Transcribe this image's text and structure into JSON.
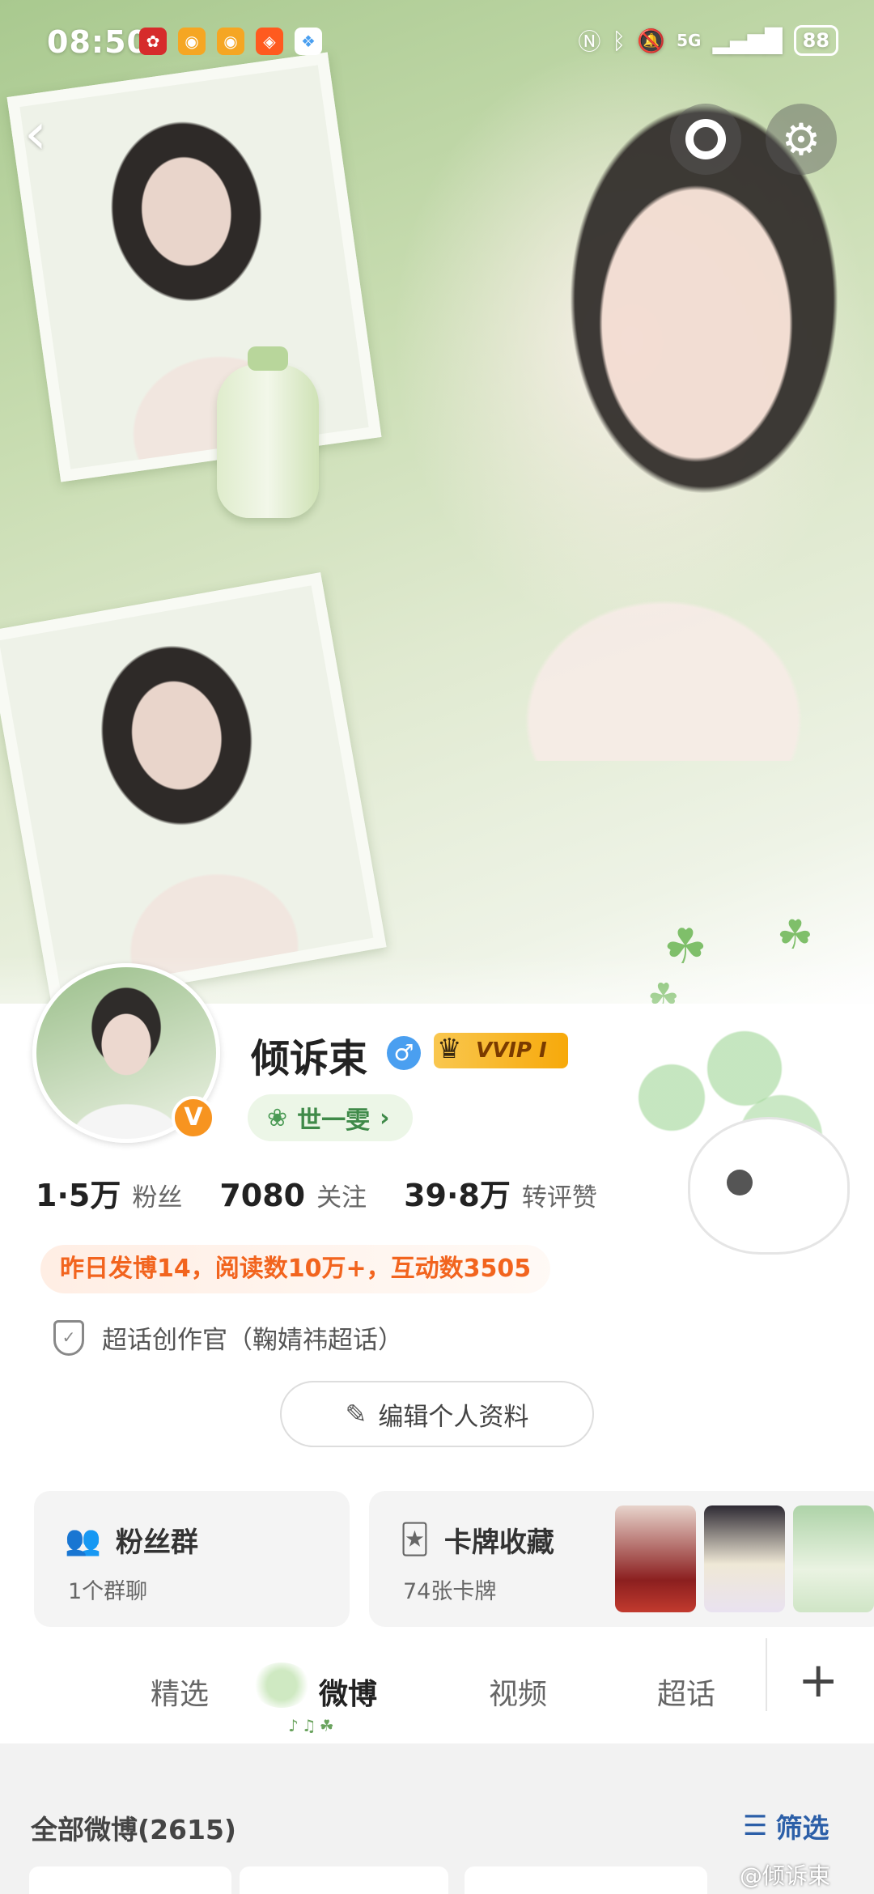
{
  "status_bar": {
    "time": "08:50",
    "network": "5G",
    "battery": "88",
    "app_icons": [
      "huawei-icon",
      "weibo-icon",
      "weibo-icon",
      "taobao-icon",
      "app-icon"
    ],
    "system_icons": [
      "nfc-icon",
      "bluetooth-icon",
      "mute-icon",
      "signal-icon"
    ]
  },
  "header": {
    "back_icon": "back-arrow-icon",
    "actions": [
      "ring-icon",
      "settings-gear-icon"
    ]
  },
  "profile": {
    "username": "倾诉束",
    "gender_symbol": "♂",
    "vip_label": "VVIP I",
    "badge_label": "世一雯",
    "verified_mark": "V",
    "stats": [
      {
        "value": "1·5万",
        "label": "粉丝"
      },
      {
        "value": "7080",
        "label": "关注"
      },
      {
        "value": "39·8万",
        "label": "转评赞"
      }
    ],
    "activity_text": "昨日发博14，阅读数10万+，互动数3505",
    "chaohua_role": "超话创作官（鞠婧祎超话）",
    "edit_button": "编辑个人资料"
  },
  "cards": {
    "fans_group": {
      "title": "粉丝群",
      "subtitle": "1个群聊"
    },
    "card_collection": {
      "title": "卡牌收藏",
      "subtitle": "74张卡牌"
    }
  },
  "tabs": [
    {
      "label": "精选",
      "active": false
    },
    {
      "label": "微博",
      "active": true
    },
    {
      "label": "视频",
      "active": false
    },
    {
      "label": "超话",
      "active": false
    }
  ],
  "feed": {
    "title": "全部微博(2615)",
    "filter_label": "筛选"
  },
  "watermark": "@倾诉束",
  "colors": {
    "accent_orange": "#f2641e",
    "badge_green": "#3f8a49",
    "link_blue": "#2c5fa8",
    "vip_gold": "#f7a90a"
  }
}
